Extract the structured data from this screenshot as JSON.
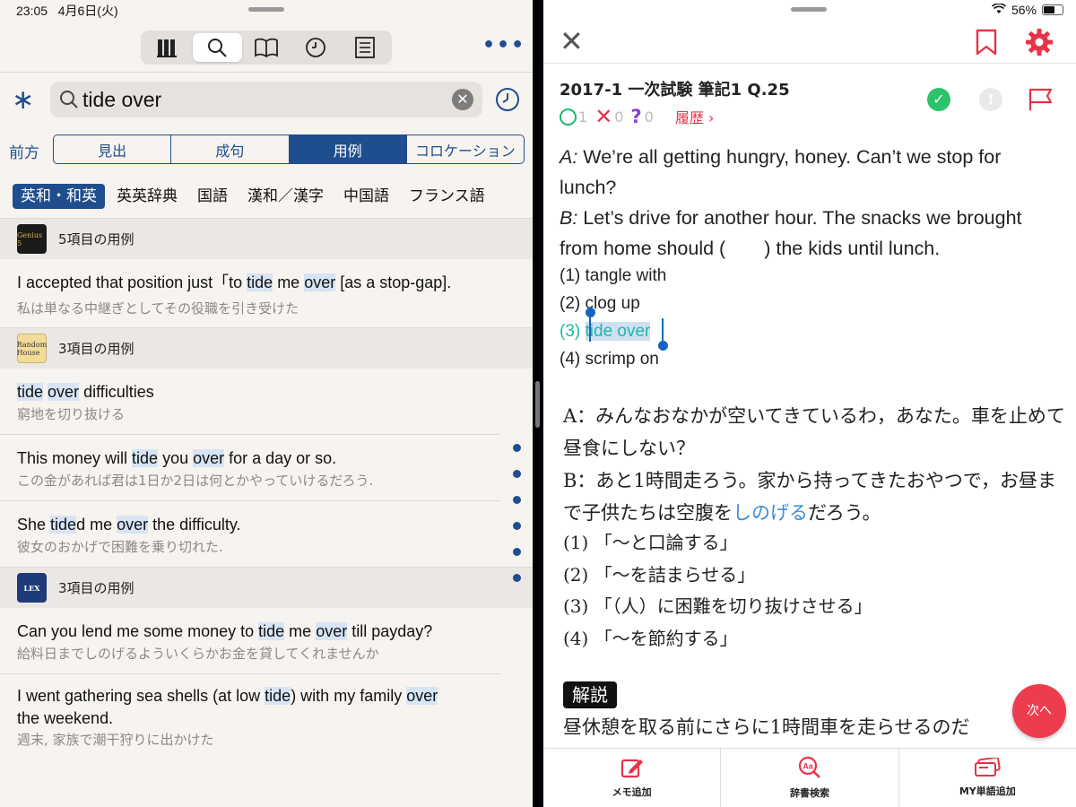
{
  "left": {
    "status": {
      "time": "23:05",
      "date": "4月6日(火)"
    },
    "toolbar": {
      "icons": [
        "library-icon",
        "search-icon",
        "book-icon",
        "history-icon",
        "list-icon"
      ],
      "more": "•••"
    },
    "search": {
      "value": "tide over",
      "placeholder": ""
    },
    "direction_label": "前方",
    "modes": [
      {
        "label": "見出",
        "active": false
      },
      {
        "label": "成句",
        "active": false
      },
      {
        "label": "用例",
        "active": true
      },
      {
        "label": "コロケーション",
        "active": false
      }
    ],
    "dict_tabs": [
      {
        "label": "英和・和英",
        "active": true
      },
      {
        "label": "英英辞典",
        "active": false
      },
      {
        "label": "国語",
        "active": false
      },
      {
        "label": "漢和／漢字",
        "active": false
      },
      {
        "label": "中国語",
        "active": false
      },
      {
        "label": "フランス語",
        "active": false
      }
    ],
    "sections": [
      {
        "header": "5項目の用例",
        "logo": "Genius 5",
        "entries": [
          {
            "en_html": "I accepted that position just「to <span class=\"hl\">tide</span> me <span class=\"hl\">over</span> [as a stop-gap].",
            "ja": "私は単なる中継ぎとしてその役職を引き受けた"
          }
        ]
      },
      {
        "header": "3項目の用例",
        "logo": "Random House",
        "entries": [
          {
            "en_html": "<span class=\"hl\">tide</span> <span class=\"hl\">over</span> difficulties",
            "ja": "窮地を切り抜ける"
          },
          {
            "en_html": "This money will <span class=\"hl\">tide</span> you <span class=\"hl\">over</span> for a day or so.",
            "ja": "この金があれば君は1日か2日は何とかやっていけるだろう."
          },
          {
            "en_html": "She <span class=\"hl\">tide</span>d me <span class=\"hl\">over</span> the difficulty.",
            "ja": "彼女のおかげで困難を乗り切れた."
          }
        ]
      },
      {
        "header": "3項目の用例",
        "logo": "LEX",
        "entries": [
          {
            "en_html": "Can you lend me some money to <span class=\"hl\">tide</span> me <span class=\"hl\">over</span> till payday?",
            "ja": "給料日までしのげるよういくらかお金を貸してくれませんか"
          },
          {
            "en_html": "I went gathering sea shells (at low <span class=\"hl\">tide</span>) with my family <span class=\"hl\">over</span> the weekend.",
            "ja": "週末, 家族で潮干狩りに出かけた"
          }
        ]
      }
    ]
  },
  "right": {
    "status": {
      "battery": "56%"
    },
    "question_title": "2017-1 一次試験 筆記1 Q.25",
    "stats": {
      "correct": "1",
      "wrong": "0",
      "unknown": "0",
      "history": "履歴"
    },
    "dialog_en": {
      "a_prefix": "A:",
      "a_text": " We’re all getting hungry, honey. Can’t we stop for lunch?",
      "b_prefix": "B:",
      "b_text": " Let’s drive for another hour. The snacks we brought from home should (  ) the kids until lunch."
    },
    "options": [
      {
        "num": "(1)",
        "text": "tangle with"
      },
      {
        "num": "(2)",
        "text": "clog up"
      },
      {
        "num": "(3)",
        "text": "tide over"
      },
      {
        "num": "(4)",
        "text": "scrimp on"
      }
    ],
    "dialog_ja": {
      "a": "A：みんなおなかが空いてきているわ，あなた。車を止めて昼食にしない？",
      "b_before": "B：あと1時間走ろう。家から持ってきたおやつで，お昼まで子供たちは空腹を",
      "b_keyword": "しのげる",
      "b_after": "だろう。"
    },
    "options_ja": [
      "(1) 「〜と口論する」",
      "(2) 「〜を詰まらせる」",
      "(3) 「（人）に困難を切り抜けさせる」",
      "(4) 「〜を節約する」"
    ],
    "explanation_badge": "解説",
    "explanation_text": "昼休憩を取る前にさらに1時間車を走らせるのだ",
    "next_button": "次へ",
    "bottom_bar": [
      {
        "label": "メモ追加",
        "icon": "memo-icon"
      },
      {
        "label": "辞書検索",
        "icon": "dictionary-search-icon"
      },
      {
        "label": "MY単語追加",
        "icon": "word-card-icon"
      }
    ],
    "colors": {
      "accent": "#e8324a",
      "correct": "#1fb8a6",
      "navy": "#1f4e8f"
    }
  }
}
